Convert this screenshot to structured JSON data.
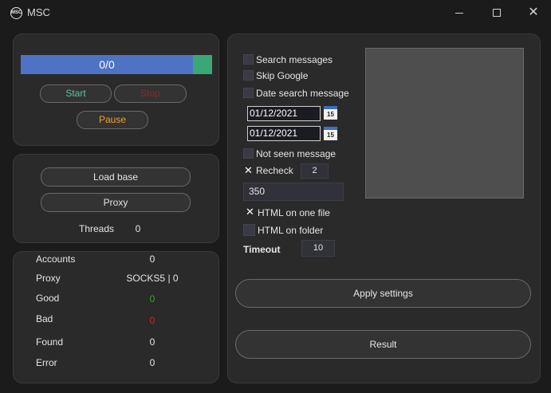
{
  "window": {
    "title": "MSC",
    "icon_text": "MSC"
  },
  "progress": {
    "text": "0/0",
    "fraction": 0.9
  },
  "controls": {
    "start": "Start",
    "stop": "Stop",
    "pause": "Pause"
  },
  "base": {
    "load_base": "Load base",
    "proxy": "Proxy",
    "threads_label": "Threads",
    "threads_value": "0"
  },
  "stats": [
    {
      "label": "Accounts",
      "value": "0",
      "color": "#e6e6e6"
    },
    {
      "label": "Proxy",
      "value": "SOCKS5 | 0",
      "color": "#e6e6e6"
    },
    {
      "label": "Good",
      "value": "0",
      "color": "#2aa82a"
    },
    {
      "label": "Bad",
      "value": "0",
      "color": "#e02020"
    },
    {
      "label": "Found",
      "value": "0",
      "color": "#e6e6e6"
    },
    {
      "label": "Error",
      "value": "0",
      "color": "#e6e6e6"
    }
  ],
  "settings": {
    "search_messages": {
      "label": "Search messages",
      "checked": false
    },
    "skip_google": {
      "label": "Skip Google",
      "checked": false
    },
    "date_search": {
      "label": "Date search message",
      "checked": false
    },
    "date_from": "01/12/2021",
    "date_to": "01/12/2021",
    "calendar_day": "15",
    "not_seen": {
      "label": "Not seen message",
      "checked": false
    },
    "recheck": {
      "label": "Recheck",
      "checked": true,
      "value": "2"
    },
    "limit_value": "350",
    "html_one_file": {
      "label": "HTML on one file",
      "checked": true
    },
    "html_folder": {
      "label": "HTML on folder",
      "checked": false
    },
    "timeout_label": "Timeout",
    "timeout_value": "10",
    "check_mark": "✕"
  },
  "actions": {
    "apply": "Apply settings",
    "result": "Result"
  }
}
